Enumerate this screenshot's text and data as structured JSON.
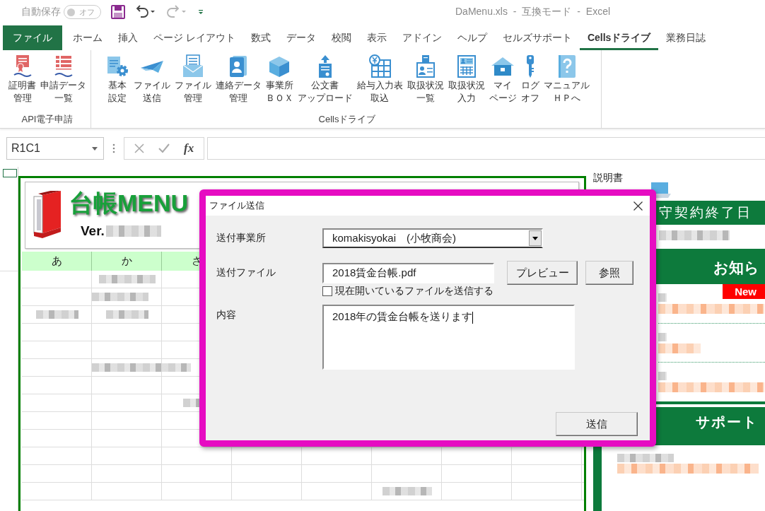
{
  "title_bar": {
    "autosave_label": "自動保存",
    "autosave": {
      "label": "オフ",
      "on": false
    },
    "quick_access": [
      {
        "kind": "save",
        "disabled": false
      },
      {
        "kind": "undo",
        "disabled": false
      },
      {
        "kind": "redo",
        "disabled": true
      },
      {
        "kind": "customize",
        "disabled": false
      }
    ],
    "title": "DaMenu.xls - 互換モード - Excel"
  },
  "tabs": [
    {
      "label": "ファイル",
      "kind": "file",
      "selected": false
    },
    {
      "label": "ホーム",
      "kind": "tab",
      "selected": false
    },
    {
      "label": "挿入",
      "kind": "tab",
      "selected": false
    },
    {
      "label": "ページ レイアウト",
      "kind": "tab",
      "selected": false
    },
    {
      "label": "数式",
      "kind": "tab",
      "selected": false
    },
    {
      "label": "データ",
      "kind": "tab",
      "selected": false
    },
    {
      "label": "校閲",
      "kind": "tab",
      "selected": false
    },
    {
      "label": "表示",
      "kind": "tab",
      "selected": false
    },
    {
      "label": "アドイン",
      "kind": "tab",
      "selected": false
    },
    {
      "label": "ヘルプ",
      "kind": "tab",
      "selected": false
    },
    {
      "label": "セルズサポート",
      "kind": "tab",
      "selected": false
    },
    {
      "label": "Cellsドライブ",
      "kind": "tab",
      "selected": true
    },
    {
      "label": "業務日誌",
      "kind": "tab",
      "selected": false
    }
  ],
  "ribbon": {
    "groups": [
      {
        "label": "API電子申請",
        "buttons": [
          {
            "lines": [
              "証明書",
              "管理"
            ]
          },
          {
            "lines": [
              "申請データ",
              "一覧"
            ]
          }
        ]
      },
      {
        "label": "Cellsドライブ",
        "buttons": [
          {
            "lines": [
              "基本",
              "設定"
            ]
          },
          {
            "lines": [
              "ファイル",
              "送信"
            ]
          },
          {
            "lines": [
              "ファイル",
              "管理"
            ]
          },
          {
            "lines": [
              "連絡データ",
              "管理"
            ]
          },
          {
            "lines": [
              "事業所",
              "ＢＯＸ"
            ]
          },
          {
            "lines": [
              "公文書",
              "アップロード"
            ]
          },
          {
            "lines": [
              "給与入力表",
              "取込"
            ]
          },
          {
            "lines": [
              "取扱状況",
              "一覧"
            ]
          },
          {
            "lines": [
              "取扱状況",
              "入力"
            ]
          },
          {
            "lines": [
              "マイ",
              "ページ"
            ]
          },
          {
            "lines": [
              "ログ",
              "オフ"
            ]
          },
          {
            "lines": [
              "マニュアル",
              "ＨＰへ"
            ]
          }
        ]
      }
    ]
  },
  "formula_bar": {
    "name_box": "R1C1",
    "function_button": "fx"
  },
  "sheet": {
    "menu_title": "台帳MENU",
    "version_label": "Ver.",
    "column_headers": [
      "あ",
      "か",
      "さ"
    ]
  },
  "right_panel": {
    "manual_label": "説明書",
    "contract_header": "守契約終了日",
    "news_header": "お知ら",
    "new_badge": "New",
    "support_header": "サポート"
  },
  "dialog": {
    "title": "ファイル送信",
    "office_label": "送付事業所",
    "office_value": "komakisyokai　(小牧商会)",
    "file_label": "送付ファイル",
    "file_value": "2018賃金台帳.pdf",
    "preview_button": "プレビュー",
    "browse_button": "参照",
    "send_current": {
      "label": "現在開いているファイルを送信する",
      "checked": false
    },
    "content_label": "内容",
    "content_value": "2018年の賃金台帳を送ります",
    "send_button": "送信"
  }
}
